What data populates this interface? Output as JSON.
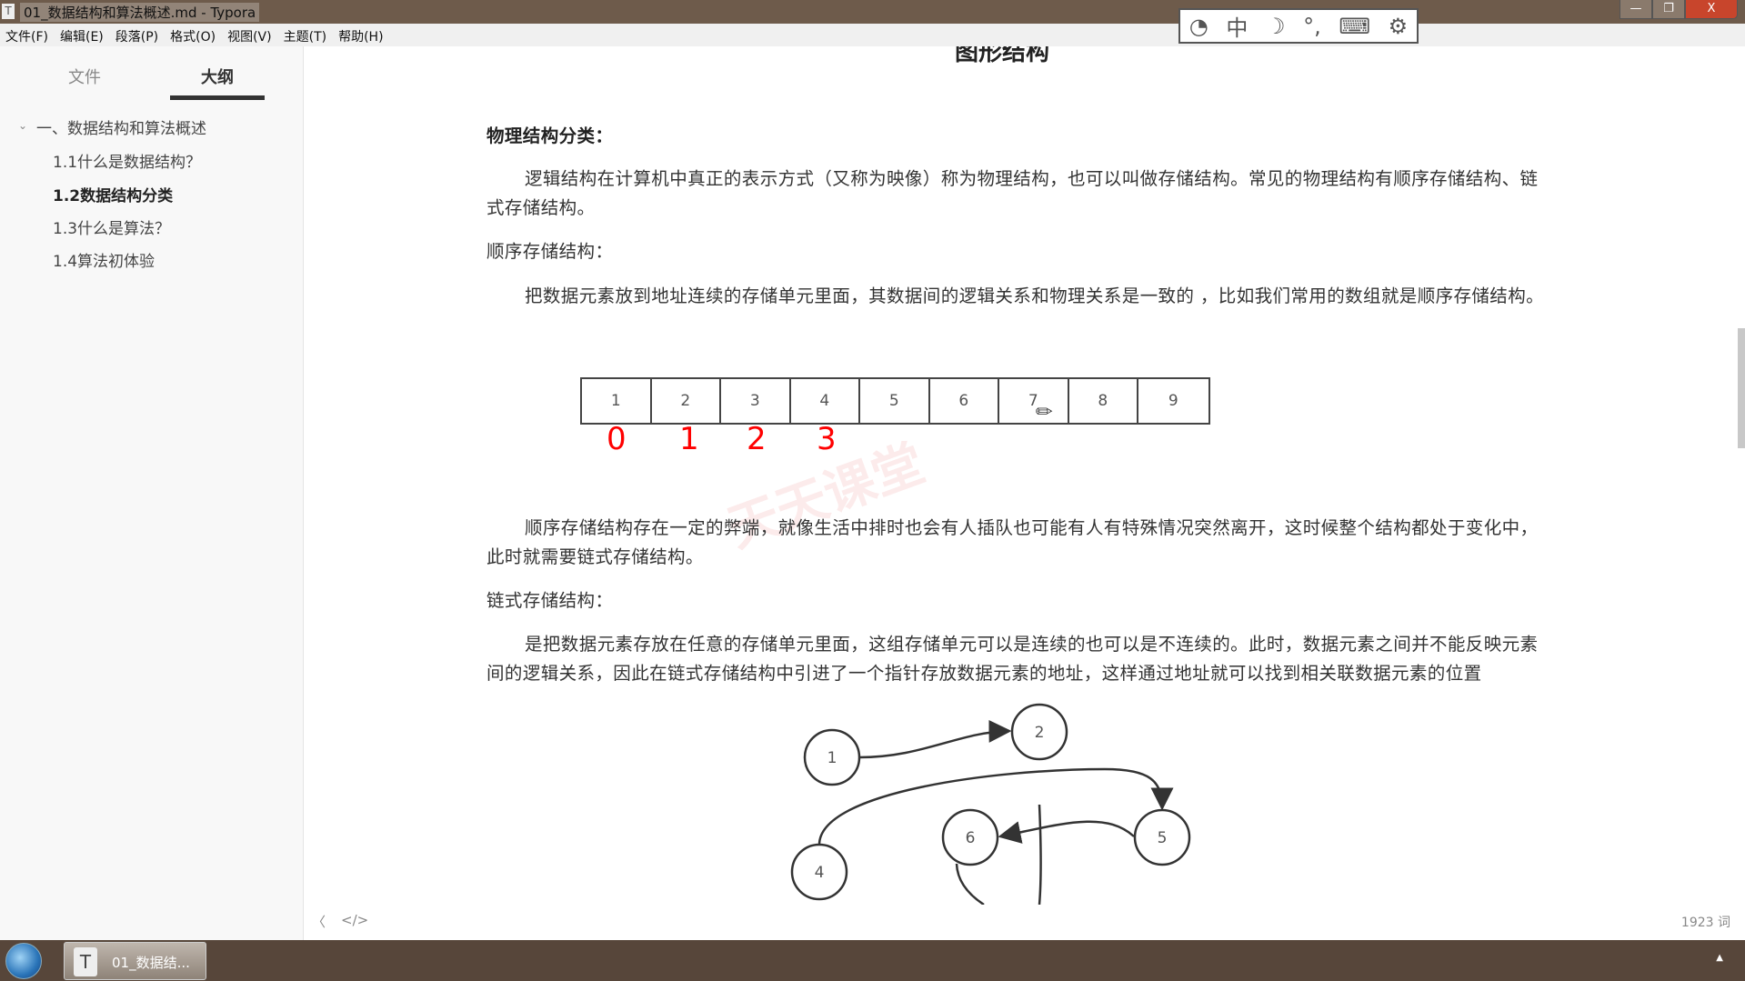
{
  "window": {
    "title": "01_数据结构和算法概述.md - Typora",
    "app_icon": "T",
    "controls": {
      "minimize": "—",
      "restore": "❐",
      "close": "X"
    }
  },
  "ime_toolbar": {
    "icons": [
      "ime-logo-icon",
      "chinese-mode-icon",
      "half-width-moon-icon",
      "punctuation-icon",
      "keyboard-icon",
      "gear-icon"
    ],
    "mode": "中"
  },
  "menu": [
    "文件(F)",
    "编辑(E)",
    "段落(P)",
    "格式(O)",
    "视图(V)",
    "主题(T)",
    "帮助(H)"
  ],
  "sidebar": {
    "tabs": [
      {
        "label": "文件",
        "active": false
      },
      {
        "label": "大纲",
        "active": true
      }
    ],
    "outline": [
      {
        "label": "一、数据结构和算法概述",
        "level": 1,
        "expanded": true
      },
      {
        "label": "1.1什么是数据结构？",
        "level": 2
      },
      {
        "label": "1.2数据结构分类",
        "level": 2,
        "active": true
      },
      {
        "label": "1.3什么是算法？",
        "level": 2
      },
      {
        "label": "1.4算法初体验",
        "level": 2
      }
    ]
  },
  "doc": {
    "cut_heading": "图形结构",
    "h_physical": "物理结构分类：",
    "p1_l1": "逻辑结构在计算机中真正的表示方式（又称为映像）称为物理结构，也可以叫做存储结构。常见的物理结构有顺序存储结构、链",
    "p1_l2": "式存储结构。",
    "h_seq": "顺序存储结构：",
    "p2": "把数据元素放到地址连续的存储单元里面，其数据间的逻辑关系和物理关系是一致的 ，比如我们常用的数组就是顺序存储结构。",
    "array": [
      "1",
      "2",
      "3",
      "4",
      "5",
      "6",
      "7",
      "8",
      "9"
    ],
    "handwritten_indices": [
      "0",
      "1",
      "2",
      "3"
    ],
    "annotation_color": "#ff0000",
    "p3_l1": "顺序存储结构存在一定的弊端，就像生活中排时也会有人插队也可能有人有特殊情况突然离开，这时候整个结构都处于变化中，",
    "p3_l2": "此时就需要链式存储结构。",
    "h_linked": "链式存储结构：",
    "p4_l1": "是把数据元素存放在任意的存储单元里面，这组存储单元可以是连续的也可以是不连续的。此时，数据元素之间并不能反映元素",
    "p4_l2": "间的逻辑关系，因此在链式存储结构中引进了一个指针存放数据元素的地址，这样通过地址就可以找到相关联数据元素的位置",
    "graph_nodes": [
      "1",
      "2",
      "4",
      "5",
      "6"
    ],
    "watermark": "天天课堂"
  },
  "status": {
    "prev": "〈",
    "source": "</>",
    "word_count": "1923 词"
  },
  "taskbar": {
    "task_label": "01_数据结...",
    "task_icon": "T",
    "tray": "▲"
  }
}
